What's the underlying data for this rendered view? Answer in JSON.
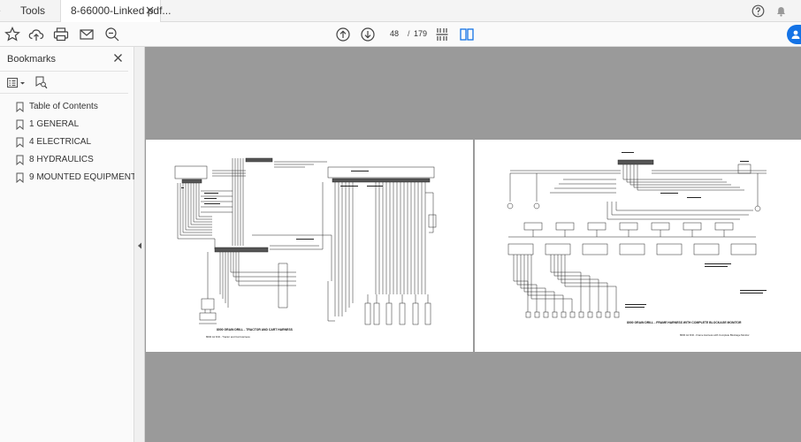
{
  "tabs": {
    "tools_label": "Tools",
    "doc_title": "8-66000-Linked pdf..."
  },
  "toolbar": {
    "current_page": "48",
    "separator": "/",
    "page_count": "179"
  },
  "sidebar": {
    "title": "Bookmarks",
    "bookmarks": [
      {
        "label": "Table of Contents"
      },
      {
        "label": "1 GENERAL"
      },
      {
        "label": "4 ELECTRICAL"
      },
      {
        "label": "8 HYDRAULICS"
      },
      {
        "label": "9 MOUNTED EQUIPMENT"
      }
    ]
  },
  "pages": {
    "left": {
      "caption": "8000 GRAIN DRILL - TRACTOR AND CART HARNESS",
      "subcaption": "8000 Air Drill - Tractor and Cart Harness"
    },
    "right": {
      "caption": "8000 GRAIN DRILL - FRAME HARNESS WITH COMPLETE BLOCKAGE MONITOR",
      "subcaption": "8000 Air Drill - Frame Harness with Complete Blockage Monitor"
    }
  },
  "colors": {
    "accent": "#1473e6",
    "viewer_bg": "#9a9a9a",
    "diagram_ink": "#222222"
  }
}
